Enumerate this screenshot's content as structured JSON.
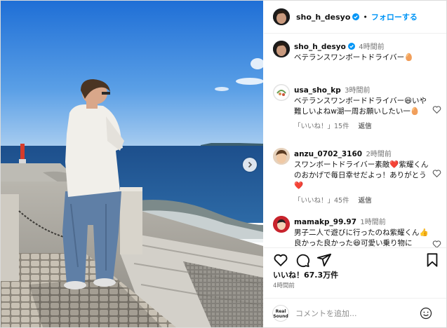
{
  "post": {
    "username": "sho_h_desyo",
    "follow_label": "フォローする",
    "separator": "•",
    "caption": {
      "username": "sho_h_desyo",
      "time": "4時間前",
      "text": "ベテランスワンボートドライバー🥚"
    },
    "comments": [
      {
        "username": "usa_sho_kp",
        "time": "3時間前",
        "text": "ベテランスワンボードドライバー😆いや難しいよねw湖一周お願いしたい一🥚",
        "likes": "「いいね！」15件",
        "reply": "返信"
      },
      {
        "username": "anzu_0702_3160",
        "time": "2時間前",
        "text": "スワンボートドライバー素敵❤️紫耀くんのおかげで毎日幸せだよっ！ありがとう❤️",
        "likes": "「いいね！」45件",
        "reply": "返信"
      },
      {
        "username": "mamakp_99.97",
        "time": "1時間前",
        "text": "男子二人で遊びに行ったのね紫耀くん👍良かった良かった😆可愛い乗り物に"
      }
    ],
    "likes_count": "いいね！67.3万件",
    "posted_ago": "4時間前",
    "comment_placeholder": "コメントを追加...",
    "realsound_logo": "Real Sound"
  },
  "icons": {
    "like": "heart-icon",
    "comment": "comment-icon",
    "share": "share-icon",
    "save": "bookmark-icon",
    "next": "chevron-right-icon",
    "emoji": "emoji-icon",
    "verified": "verified-badge-icon"
  },
  "colors": {
    "link_blue": "#0095f6",
    "verified_blue": "#0095f6",
    "muted": "#737373"
  }
}
